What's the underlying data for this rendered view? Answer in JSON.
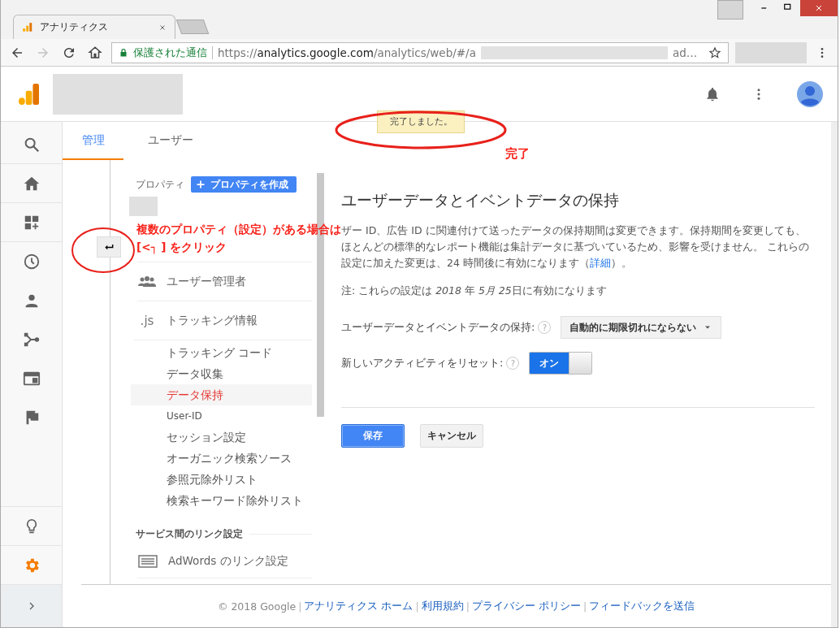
{
  "browser": {
    "tab_title": "アナリティクス",
    "secure_label": "保護された通信",
    "url_start": "https://analytics.google.com/analytics/web/#/a",
    "url_end": "ad…"
  },
  "rail": [
    {
      "selected": false
    },
    {
      "selected": false
    },
    {
      "selected": false
    },
    {
      "selected": false
    },
    {
      "selected": false
    },
    {
      "selected": false
    },
    {
      "selected": false
    },
    {
      "selected": false
    },
    {
      "selected": false
    },
    {
      "selected": true
    }
  ],
  "toast": "完了しました。",
  "tabs": [
    {
      "label": "管理",
      "selected": true
    },
    {
      "label": "ユーザー",
      "selected": false
    }
  ],
  "property": {
    "label": "プロパティ",
    "create_button": "プロパティを作成"
  },
  "nav": [
    {
      "kind": "group",
      "label": "ユーザー管理者"
    },
    {
      "kind": "code",
      "badge": ".js",
      "label": "トラッキング情報",
      "children": [
        {
          "label": "トラッキング コード",
          "selected": false
        },
        {
          "label": "データ収集",
          "selected": false
        },
        {
          "label": "データ保持",
          "selected": true
        },
        {
          "label": "User-ID",
          "selected": false
        },
        {
          "label": "セッション設定",
          "selected": false
        },
        {
          "label": "オーガニック検索ソース",
          "selected": false
        },
        {
          "label": "参照元除外リスト",
          "selected": false
        },
        {
          "label": "検索キーワード除外リスト",
          "selected": false
        }
      ]
    },
    {
      "kind": "heading",
      "label": "サービス間のリンク設定"
    },
    {
      "kind": "adwords",
      "label": "AdWords のリンク設定"
    }
  ],
  "panel": {
    "title": "ユーザーデータとイベントデータの保持",
    "description": "ザー ID、広告 ID に関連付けて送ったデータの保持期間は変更できます。保持期間を変更しても、ほとんどの標準的なレポート機能は集計データに基づいているため、影響を受けません。 これらの設定に加えた変更は、24 時間後に有効になります（",
    "more_link": "詳細",
    "description_end": "）。",
    "note": [
      {
        "text": "注: これらの設定は ",
        "italic": false
      },
      {
        "text": "2018",
        "italic": true
      },
      {
        "text": " 年 ",
        "italic": false
      },
      {
        "text": "5月 25",
        "italic": true
      },
      {
        "text": "日に有効になります",
        "italic": false
      }
    ],
    "settings": [
      {
        "kind": "dropdown",
        "label": "ユーザーデータとイベントデータの保持:",
        "help": "?",
        "value": "自動的に期限切れにならない"
      },
      {
        "kind": "toggle",
        "label": "新しいアクティビティをリセット:",
        "help": "?",
        "on": true,
        "on_label": "オン"
      }
    ],
    "buttons": [
      {
        "kind": "primary",
        "label": "保存"
      },
      {
        "kind": "secondary",
        "label": "キャンセル"
      }
    ]
  },
  "footer": {
    "copyright": "© 2018 Google",
    "separator": "|",
    "links": [
      "アナリティクス ホーム",
      "利用規約",
      "プライバシー ポリシー",
      "フィードバックを送信"
    ]
  },
  "annotations": {
    "done_label": "完了",
    "instruction": [
      "複数のプロパティ（設定）がある場合は",
      "[<┐ ] をクリック"
    ]
  }
}
